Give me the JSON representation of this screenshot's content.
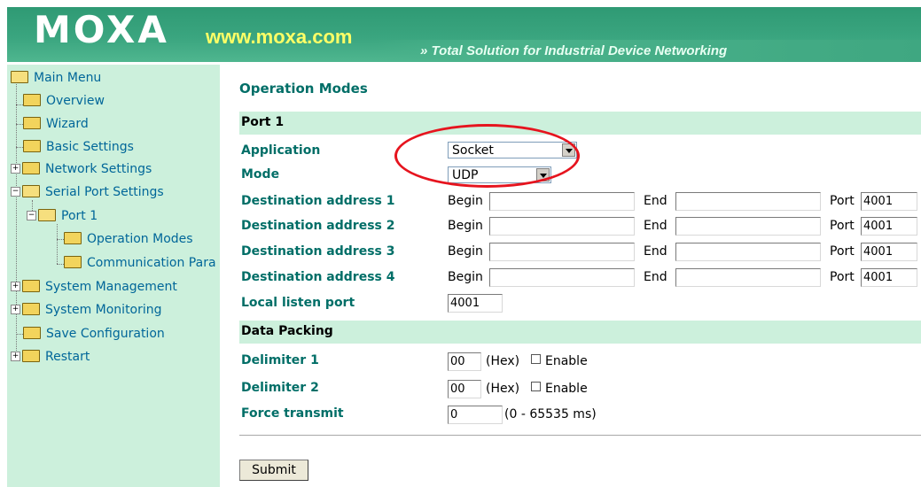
{
  "header": {
    "logo": "MOXA",
    "site": "www.moxa.com",
    "tagline": "» Total Solution for Industrial Device Networking"
  },
  "sidebar": {
    "items": [
      {
        "label": "Main Menu"
      },
      {
        "label": "Overview"
      },
      {
        "label": "Wizard"
      },
      {
        "label": "Basic Settings"
      },
      {
        "label": "Network Settings"
      },
      {
        "label": "Serial Port Settings"
      },
      {
        "label": "Port 1"
      },
      {
        "label": "Operation Modes"
      },
      {
        "label": "Communication Para"
      },
      {
        "label": "System Management"
      },
      {
        "label": "System Monitoring"
      },
      {
        "label": "Save Configuration"
      },
      {
        "label": "Restart"
      }
    ],
    "expander_plus": "+",
    "expander_minus": "−"
  },
  "main": {
    "title": "Operation Modes",
    "port_section": "Port 1",
    "application_label": "Application",
    "application_value": "Socket",
    "mode_label": "Mode",
    "mode_value": "UDP",
    "destinations": [
      {
        "label": "Destination address 1",
        "begin_label": "Begin",
        "begin_value": "",
        "end_label": "End",
        "end_value": "",
        "port_label": "Port",
        "port_value": "4001"
      },
      {
        "label": "Destination address 2",
        "begin_label": "Begin",
        "begin_value": "",
        "end_label": "End",
        "end_value": "",
        "port_label": "Port",
        "port_value": "4001"
      },
      {
        "label": "Destination address 3",
        "begin_label": "Begin",
        "begin_value": "",
        "end_label": "End",
        "end_value": "",
        "port_label": "Port",
        "port_value": "4001"
      },
      {
        "label": "Destination address 4",
        "begin_label": "Begin",
        "begin_value": "",
        "end_label": "End",
        "end_value": "",
        "port_label": "Port",
        "port_value": "4001"
      }
    ],
    "local_listen_label": "Local listen port",
    "local_listen_value": "4001",
    "data_packing_section": "Data Packing",
    "delimiter1_label": "Delimiter 1",
    "delimiter1_value": "00",
    "delimiter2_label": "Delimiter 2",
    "delimiter2_value": "00",
    "hex_label": "(Hex)",
    "enable_label": "Enable",
    "force_transmit_label": "Force transmit",
    "force_transmit_value": "0",
    "force_transmit_range": "(0 - 65535 ms)",
    "submit_label": "Submit"
  },
  "colors": {
    "header_green": "#3aa57f",
    "sidebar_bg": "#ccf0dc",
    "label_teal": "#006e67",
    "link_blue": "#006699",
    "highlight_red": "#e6141e"
  }
}
